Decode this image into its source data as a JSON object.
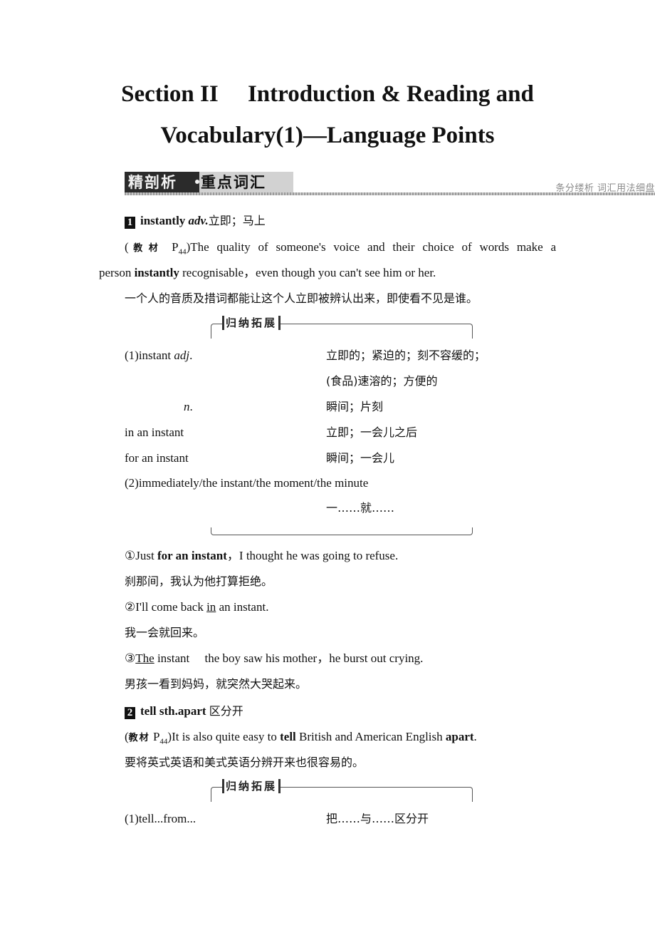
{
  "title": {
    "line1": "Section II  Introduction & Reading and",
    "line2": "Vocabulary(1)—Language Points"
  },
  "section_band": {
    "dark_label": "精剖析",
    "light_label": "重点词汇",
    "right_note": "条分缕析 词汇用法细盘"
  },
  "items": [
    {
      "number": "1",
      "headword": "instantly",
      "pos": "adv.",
      "meaning": "立即；马上",
      "source_label": "教材",
      "source_page": "P",
      "source_page_sub": "44",
      "example_part1": ")The quality of someone's voice and their choice of words make a",
      "example_part2_pre": "person ",
      "example_part2_bold": "instantly",
      "example_part2_post": " recognisable，even though you can't see him or her.",
      "translation": "一个人的音质及措词都能让这个人立即被辨认出来，即使看不见是谁。",
      "expansion": {
        "label": "归纳拓展",
        "rows": [
          {
            "left": "(1)instant ",
            "left_italic": "adj",
            "left_tail": ".",
            "right": "立即的；紧迫的；刻不容缓的；"
          },
          {
            "left": "",
            "left_italic": "",
            "left_tail": "",
            "right": "(食品)速溶的；方便的"
          },
          {
            "left": "",
            "left_italic": "n",
            "left_tail": ".",
            "right": "瞬间；片刻"
          },
          {
            "left": "in an instant",
            "left_italic": "",
            "left_tail": "",
            "right": "立即；一会儿之后"
          },
          {
            "left": "for an instant",
            "left_italic": "",
            "left_tail": "",
            "right": "瞬间；一会儿"
          },
          {
            "left": "(2)immediately/the instant/the moment/the minute",
            "left_italic": "",
            "left_tail": "",
            "right": ""
          },
          {
            "left": "",
            "left_italic": "",
            "left_tail": "",
            "right": "一……就……"
          }
        ]
      },
      "examples": [
        {
          "marker": "①",
          "pre": "Just ",
          "bold": "for an instant",
          "post": "，I thought he was going to refuse.",
          "translation": "刹那间，我认为他打算拒绝。"
        },
        {
          "marker": "②",
          "pre": "I'll come back ",
          "underline": "in",
          "post": " an instant.",
          "translation": "我一会就回来。"
        },
        {
          "marker": "③",
          "underline": "The",
          "post": " instant  the boy saw his mother，he burst out crying.",
          "translation": "男孩一看到妈妈，就突然大哭起来。"
        }
      ]
    },
    {
      "number": "2",
      "headword": "tell sth.apart",
      "meaning": "区分开",
      "source_label": "教材",
      "source_page": "P",
      "source_page_sub": "44",
      "example_pre": ")It is also quite easy to ",
      "example_bold1": "tell",
      "example_mid": " British and American English ",
      "example_bold2": "apart",
      "example_post": ".",
      "translation": "要将英式英语和美式英语分辨开来也很容易的。",
      "expansion": {
        "label": "归纳拓展",
        "rows": [
          {
            "left": "(1)tell...from...",
            "right": "把……与……区分开"
          }
        ]
      }
    }
  ]
}
